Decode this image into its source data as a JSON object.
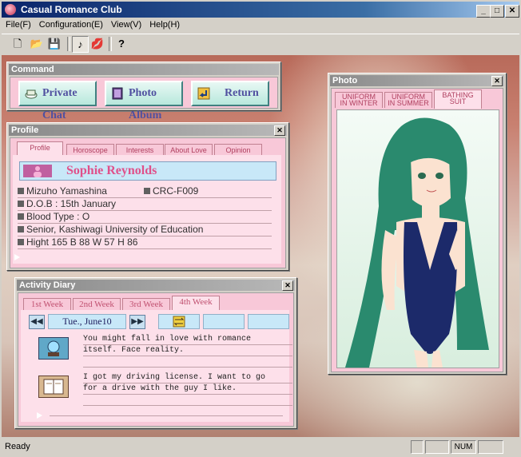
{
  "window": {
    "title": "Casual Romance Club",
    "minimize": "_",
    "maximize": "□",
    "close": "✕"
  },
  "menu": [
    {
      "label": "File(F)"
    },
    {
      "label": "Configuration(E)"
    },
    {
      "label": "View(V)"
    },
    {
      "label": "Help(H)"
    }
  ],
  "toolbar": {
    "new": "🗋",
    "open": "📂",
    "save": "💾",
    "music": "♪",
    "lips": "💋",
    "help": "?"
  },
  "command": {
    "title": "Command",
    "buttons": [
      {
        "label": "Private Chat",
        "icon": "cup-icon"
      },
      {
        "label": "Photo Album",
        "icon": "album-icon"
      },
      {
        "label": "Return",
        "icon": "return-arrow-icon"
      }
    ]
  },
  "profile": {
    "title": "Profile",
    "close": "✕",
    "tabs": [
      "Profile",
      "Horoscope",
      "Interests",
      "About Love",
      "Opinion"
    ],
    "name": "Sophie Reynolds",
    "voice": "Mizuho Yamashina",
    "code": "CRC-F009",
    "dob": "D.O.B : 15th January",
    "blood": "Blood Type : O",
    "school": "Senior, Kashiwagi University of Education",
    "measure": "Hight 165 B 88 W 57 H 86"
  },
  "photo": {
    "title": "Photo",
    "close": "✕",
    "tabs": [
      {
        "l1": "UNIFORM",
        "l2": "IN WINTER"
      },
      {
        "l1": "UNIFORM",
        "l2": "IN SUMMER"
      },
      {
        "l1": "BATHING",
        "l2": "SUIT"
      }
    ]
  },
  "diary": {
    "title": "Activity Diary",
    "close": "✕",
    "tabs": [
      "1st Week",
      "2nd Week",
      "3rd Week",
      "4th Week"
    ],
    "prev": "◀◀",
    "next": "▶▶",
    "date": "Tue., June10",
    "entries": [
      {
        "icon": "crystal-ball-icon",
        "line1": "You might fall in love with romance",
        "line2": "itself. Face reality."
      },
      {
        "icon": "notebook-icon",
        "line1": "I got my driving license. I want to go",
        "line2": "for a drive with the guy I like."
      }
    ]
  },
  "status": {
    "text": "Ready",
    "num": "NUM"
  },
  "colors": {
    "pink": "#f8c8d8",
    "lightpink": "#fde0ea",
    "title_blue": "#0a246a",
    "name_pink": "#e0508a"
  }
}
